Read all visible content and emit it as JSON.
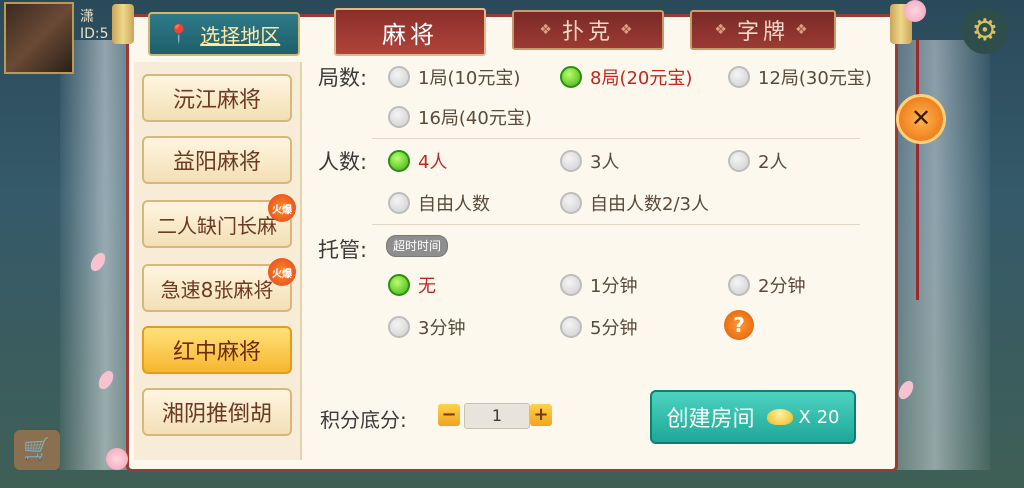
{
  "header": {
    "region_label": "选择地区",
    "tabs": [
      {
        "label": "麻将",
        "active": true
      },
      {
        "label": "扑克",
        "active": false
      },
      {
        "label": "字牌",
        "active": false
      }
    ],
    "avatar_name": "潇",
    "avatar_id": "ID:5"
  },
  "sidebar": {
    "items": [
      {
        "label": "沅江麻将",
        "hot": false,
        "active": false
      },
      {
        "label": "益阳麻将",
        "hot": false,
        "active": false
      },
      {
        "label": "二人缺门长麻",
        "hot": true,
        "active": false
      },
      {
        "label": "急速8张麻将",
        "hot": true,
        "active": false
      },
      {
        "label": "红中麻将",
        "hot": false,
        "active": true
      },
      {
        "label": "湘阴推倒胡",
        "hot": false,
        "active": false
      }
    ],
    "hot_badge": "火爆"
  },
  "rounds": {
    "label": "局数:",
    "options": [
      {
        "label": "1局(10元宝)",
        "selected": false
      },
      {
        "label": "8局(20元宝)",
        "selected": true
      },
      {
        "label": "12局(30元宝)",
        "selected": false
      },
      {
        "label": "16局(40元宝)",
        "selected": false
      }
    ]
  },
  "players": {
    "label": "人数:",
    "options": [
      {
        "label": "4人",
        "selected": true
      },
      {
        "label": "3人",
        "selected": false
      },
      {
        "label": "2人",
        "selected": false
      },
      {
        "label": "自由人数",
        "selected": false
      },
      {
        "label": "自由人数2/3人",
        "selected": false
      }
    ]
  },
  "autoplay": {
    "label": "托管:",
    "badge": "超时时间",
    "options": [
      {
        "label": "无",
        "selected": true
      },
      {
        "label": "1分钟",
        "selected": false
      },
      {
        "label": "2分钟",
        "selected": false
      },
      {
        "label": "3分钟",
        "selected": false
      },
      {
        "label": "5分钟",
        "selected": false
      }
    ],
    "help": "?"
  },
  "score": {
    "label": "积分底分:",
    "minus": "−",
    "value": "1",
    "plus": "+"
  },
  "create": {
    "label": "创建房间",
    "cost": "X 20"
  },
  "close_symbol": "✕",
  "colors": {
    "panel_border": "#9a3a34",
    "accent_red": "#c0281e",
    "create_button": "#1ea898",
    "active_item": "#f6b62e"
  }
}
